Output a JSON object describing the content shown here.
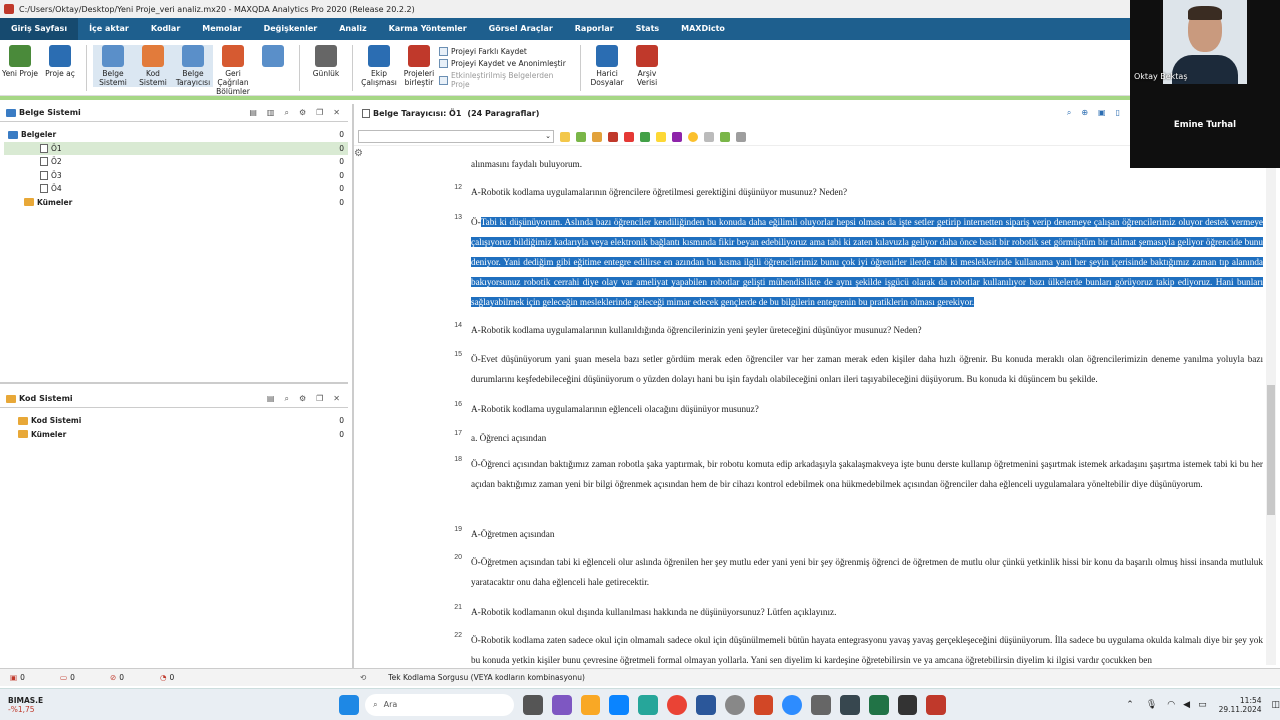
{
  "window": {
    "title": "C:/Users/Oktay/Desktop/Yeni Proje_veri analiz.mx20 - MAXQDA Analytics Pro 2020 (Release 20.2.2)"
  },
  "menu": [
    "Giriş Sayfası",
    "İçe aktar",
    "Kodlar",
    "Memolar",
    "Değişkenler",
    "Analiz",
    "Karma Yöntemler",
    "Görsel Araçlar",
    "Raporlar",
    "Stats",
    "MAXDicto"
  ],
  "ribbon": {
    "buttons": [
      {
        "label": "Yeni Proje",
        "icon": "new-project-icon",
        "color": "#4a8a3a"
      },
      {
        "label": "Proje aç",
        "icon": "open-project-icon",
        "color": "#2b6db2"
      },
      {
        "label": "Belge Sistemi",
        "icon": "document-system-icon",
        "color": "#5a8fc9"
      },
      {
        "label": "Kod Sistemi",
        "icon": "code-system-icon",
        "color": "#e27b3b"
      },
      {
        "label": "Belge Tarayıcısı",
        "icon": "document-browser-icon",
        "color": "#5a8fc9"
      },
      {
        "label": "Geri Çağrılan Bölümler",
        "icon": "retrieved-segments-icon",
        "color": "#d65a31"
      },
      {
        "label": "",
        "icon": "grid-icon",
        "color": "#5a8fc9"
      },
      {
        "label": "Günlük",
        "icon": "logbook-icon",
        "color": "#666"
      },
      {
        "label": "Ekip Çalışması",
        "icon": "teamwork-icon",
        "color": "#2b6db2"
      },
      {
        "label": "Projeleri birleştir",
        "icon": "merge-projects-icon",
        "color": "#c0392b"
      }
    ],
    "small": [
      "Projeyi Farklı Kaydet",
      "Projeyi Kaydet ve Anonimleştir",
      "Etkinleştirilmiş Belgelerden Proje"
    ],
    "right_buttons": [
      {
        "label": "Harici Dosyalar",
        "icon": "external-files-icon",
        "color": "#2b6db2"
      },
      {
        "label": "Arşiv Verisi",
        "icon": "archive-icon",
        "color": "#c0392b"
      }
    ]
  },
  "documents_panel": {
    "title": "Belge Sistemi",
    "items": [
      {
        "label": "Belgeler",
        "count": "0",
        "type": "folder"
      },
      {
        "label": "Ö1",
        "count": "0",
        "type": "doc",
        "selected": true
      },
      {
        "label": "Ö2",
        "count": "0",
        "type": "doc"
      },
      {
        "label": "Ö3",
        "count": "0",
        "type": "doc"
      },
      {
        "label": "Ö4",
        "count": "0",
        "type": "doc"
      },
      {
        "label": "Kümeler",
        "count": "0",
        "type": "set"
      }
    ]
  },
  "codes_panel": {
    "title": "Kod Sistemi",
    "items": [
      {
        "label": "Kod Sistemi",
        "count": "0"
      },
      {
        "label": "Kümeler",
        "count": "0"
      }
    ]
  },
  "document_browser": {
    "title": "Belge Tarayıcısı: Ö1",
    "subtitle": "(24 Paragraflar)",
    "paragraphs": [
      {
        "num": "",
        "text": "alınmasını faydalı buluyorum."
      },
      {
        "num": "12",
        "text": "A-Robotik kodlama uygulamalarının öğrencilere öğretilmesi gerektiğini düşünüyor musunuz? Neden?"
      },
      {
        "num": "13",
        "text": "Tabi ki düşünüyorum. Aslında bazı öğrenciler kendiliğinden bu konuda daha eğilimli oluyorlar hepsi olmasa da işte setler getirip internetten sipariş verip denemeye çalışan öğrencilerimiz oluyor destek vermeye çalışıyoruz bildiğimiz kadarıyla veya elektronik bağlantı kısmında fikir beyan edebiliyoruz ama tabi ki zaten kılavuzla geliyor daha önce basit bir robotik set görmüştüm bir talimat şemasıyla geliyor öğrencide bunu deniyor. Yani dediğim gibi eğitime entegre edilirse en azından bu kısma ilgili öğrencilerimiz bunu çok iyi öğrenirler ilerde tabi ki mesleklerinde kullanama yani her şeyin içerisinde baktığımız zaman tıp alanında bakıyorsunuz robotik cerrahi diye olay var ameliyat yapabilen robotlar gelişti mühendislikte de aynı şekilde işgücü olarak da robotlar kullanılıyor bazı ülkelerde bunları görüyoruz takip ediyoruz. Hani bunları sağlayabilmek için geleceğin mesleklerinde geleceği mimar edecek gençlerde de bu bilgilerin entegrenin bu pratiklerin olması gerekiyor.",
        "prefix": "Ö-"
      },
      {
        "num": "14",
        "text": "A-Robotik kodlama uygulamalarının kullanıldığında öğrencilerinizin yeni şeyler üreteceğini düşünüyor musunuz? Neden?"
      },
      {
        "num": "15",
        "text": "Ö-Evet düşünüyorum yani şuan mesela bazı setler gördüm merak eden öğrenciler var her zaman merak eden kişiler daha hızlı öğrenir. Bu konuda meraklı olan öğrencilerimizin deneme yanılma yoluyla bazı durumlarını keşfedebileceğini düşünüyorum o yüzden dolayı hani bu işin faydalı olabileceğini onları ileri taşıyabileceğini düşüyorum. Bu konuda ki düşüncem bu şekilde."
      },
      {
        "num": "16",
        "text": "A-Robotik kodlama uygulamalarının eğlenceli olacağını düşünüyor musunuz?"
      },
      {
        "num": "17",
        "text": "a.      Öğrenci açısından"
      },
      {
        "num": "18",
        "text": "Ö-Öğrenci açısından baktığımız zaman robotla şaka yaptırmak, bir robotu komuta edip arkadaşıyla şakalaşmakveya işte bunu derste kullanıp öğretmenini şaşırtmak istemek arkadaşını şaşırtma istemek tabi ki bu her açıdan baktığımız zaman yeni bir bilgi öğrenmek açısından hem de bir cihazı kontrol edebilmek ona hükmedebilmek açısından öğrenciler daha eğlenceli uygulamalara yöneltebilir diye düşünüyorum."
      },
      {
        "num": "19",
        "text": "A-Öğretmen açısından"
      },
      {
        "num": "20",
        "text": "Ö-Öğretmen açısından tabi ki eğlenceli olur aslında öğrenilen her şey mutlu eder yani yeni bir şey öğrenmiş öğrenci de öğretmen de mutlu olur çünkü yetkinlik hissi bir konu da başarılı olmuş hissi insanda mutluluk yaratacaktır onu daha eğlenceli hale getirecektir."
      },
      {
        "num": "21",
        "text": "A-Robotik kodlamanın okul dışında kullanılması hakkında ne düşünüyorsunuz? Lütfen açıklayınız."
      },
      {
        "num": "22",
        "text": "Ö-Robotik kodlama zaten sadece okul için olmamalı sadece okul için düşünülmemeli bütün hayata entegrasyonu yavaş yavaş gerçekleşeceğini düşünüyorum. İlla sadece bu uygulama okulda kalmalı diye bir şey yok bu konuda yetkin kişiler bunu çevresine öğretmeli formal olmayan yollarla. Yani sen diyelim ki kardeşine öğretebilirsin ve ya amcana öğretebilirsin diyelim ki ilgisi vardır çocukken ben"
      }
    ]
  },
  "status": {
    "items": [
      "0",
      "0",
      "0",
      "0"
    ],
    "query": "Tek Kodlama Sorgusu (VEYA kodların kombinasyonu)"
  },
  "taskbar": {
    "stock_name": "BIMAS.E",
    "stock_change": "-%1,75",
    "search": "Ara",
    "time": "11:54",
    "date": "29.11.2024"
  },
  "video": {
    "person1": "Oktay Bektaş",
    "person2": "Emine Turhal"
  }
}
